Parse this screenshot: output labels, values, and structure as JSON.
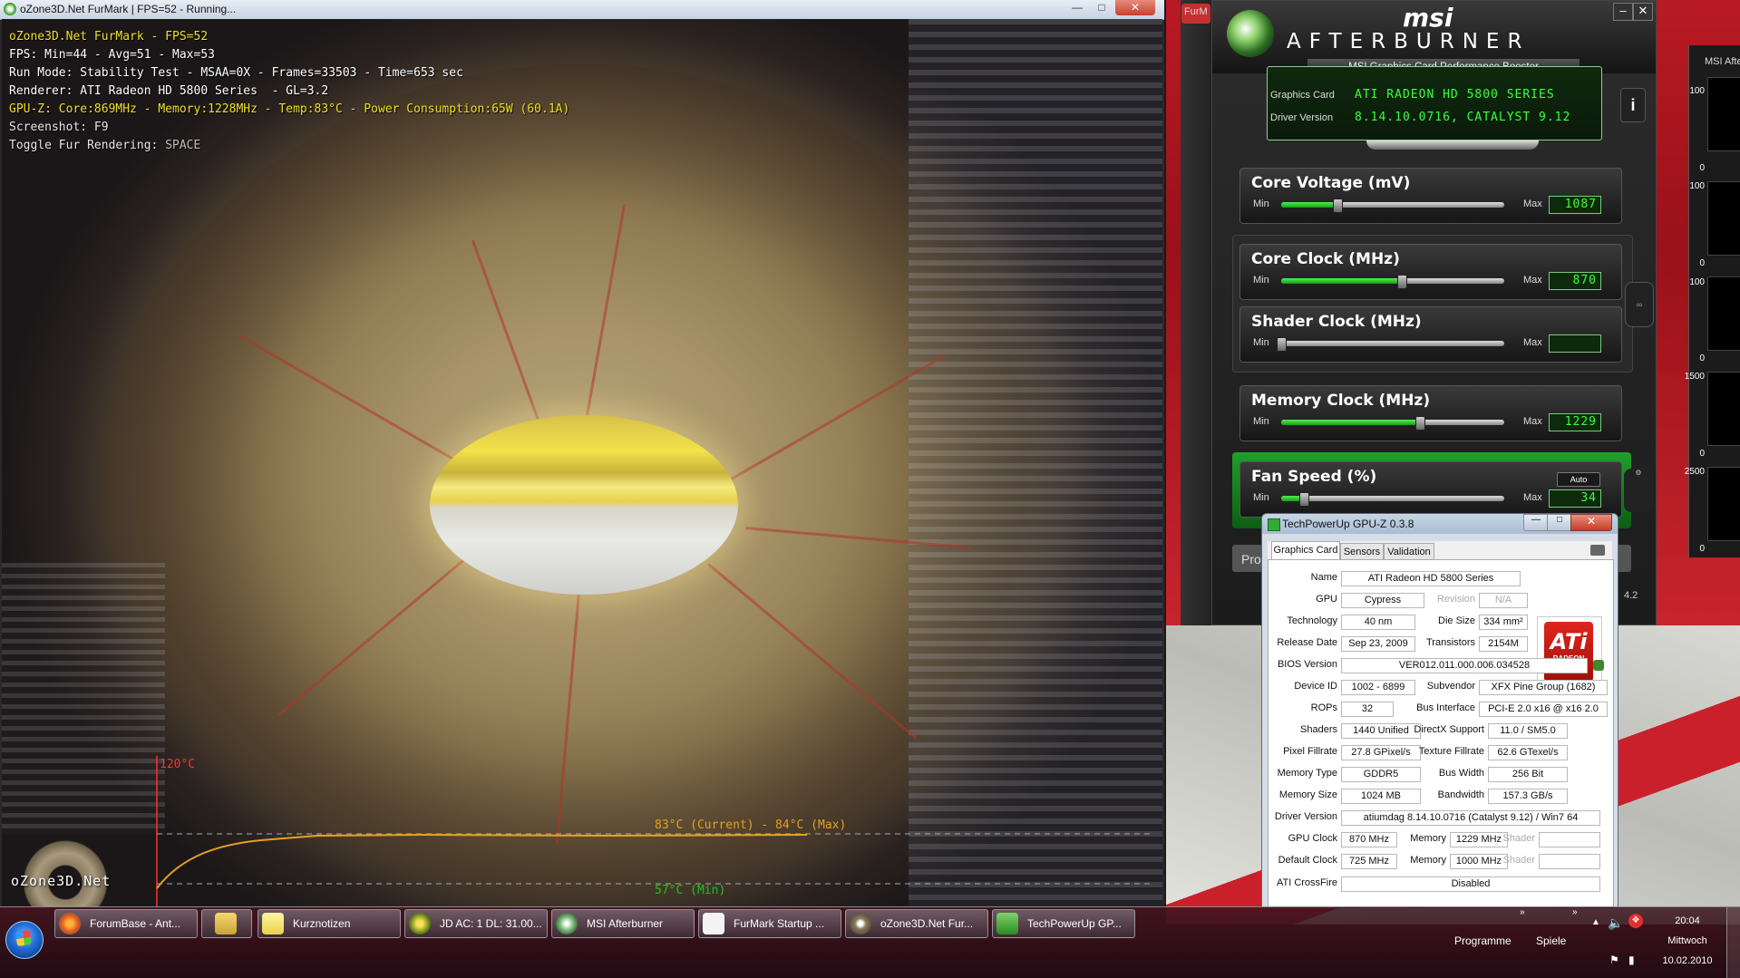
{
  "colors": {
    "furmark_yellow": "#f0e020",
    "ab_green": "#3cff3c",
    "temp_max": "#ff3030",
    "temp_current": "#e8a020",
    "temp_min": "#20c020",
    "ati_red": "#e0251e"
  },
  "furmark": {
    "window_title": "oZone3D.Net FurMark | FPS=52 - Running...",
    "lines": {
      "l1": "oZone3D.Net FurMark - FPS=52",
      "l2": "FPS: Min=44 - Avg=51 - Max=53",
      "l3": "Run Mode: Stability Test - MSAA=0X - Frames=33503 - Time=653 sec",
      "l4": "Renderer: ATI Radeon HD 5800 Series  - GL=3.2",
      "l5": "GPU-Z: Core:869MHz - Memory:1228MHz - Temp:83°C - Power Consumption:65W (60.1A)",
      "l6_label": "Screenshot: ",
      "l6_key": "F9",
      "l7_label": "Toggle Fur Rendering: ",
      "l7_key": "SPACE"
    },
    "graph": {
      "max_label": "120°C",
      "current_label": "83°C (Current) - 84°C (Max)",
      "min_label": "57°C (Min)"
    },
    "logo": "oZone3D.Net"
  },
  "afterburner": {
    "brand": "msi",
    "name": "AFTERBURNER",
    "subtitle": "MSI Graphics Card Performance Booster",
    "edge_title": "FurM",
    "graphics_card_label": "Graphics Card",
    "graphics_card_value": "ATI RADEON HD 5800 SERIES",
    "driver_label": "Driver Version",
    "driver_value": "8.14.10.0716, CATALYST 9.12",
    "min_label": "Min",
    "max_label": "Max",
    "core_voltage": {
      "title": "Core Voltage (mV)",
      "value": "1087",
      "level": 0.25
    },
    "core_clock": {
      "title": "Core Clock (MHz)",
      "value": "870",
      "level": 0.54
    },
    "shader_clock": {
      "title": "Shader Clock (MHz)",
      "value": "",
      "level": 0.0
    },
    "memory_clock": {
      "title": "Memory Clock (MHz)",
      "value": "1229",
      "level": 0.62
    },
    "fan_speed": {
      "title": "Fan Speed (%)",
      "value": "34",
      "level": 0.1,
      "auto": "Auto"
    },
    "bottom_text": "Pro",
    "version": "4.2"
  },
  "monitor": {
    "title": "MSI Afte",
    "ticks": [
      "100",
      "0",
      "100",
      "0",
      "100",
      "0",
      "1500",
      "0",
      "2500",
      "0"
    ]
  },
  "gpuz": {
    "title": "TechPowerUp GPU-Z 0.3.8",
    "tabs": [
      "Graphics Card",
      "Sensors",
      "Validation"
    ],
    "name_label": "Name",
    "name": "ATI Radeon HD 5800 Series",
    "gpu_label": "GPU",
    "gpu": "Cypress",
    "revision_label": "Revision",
    "revision": "N/A",
    "technology_label": "Technology",
    "technology": "40 nm",
    "die_size_label": "Die Size",
    "die_size": "334 mm²",
    "release_date_label": "Release Date",
    "release_date": "Sep 23, 2009",
    "transistors_label": "Transistors",
    "transistors": "2154M",
    "bios_label": "BIOS Version",
    "bios": "VER012.011.000.006.034528",
    "device_id_label": "Device ID",
    "device_id": "1002 - 6899",
    "subvendor_label": "Subvendor",
    "subvendor": "XFX Pine Group (1682)",
    "rops_label": "ROPs",
    "rops": "32",
    "bus_interface_label": "Bus Interface",
    "bus_interface": "PCI-E 2.0 x16 @ x16 2.0",
    "shaders_label": "Shaders",
    "shaders": "1440 Unified",
    "directx_label": "DirectX Support",
    "directx": "11.0 / SM5.0",
    "pixel_fillrate_label": "Pixel Fillrate",
    "pixel_fillrate": "27.8 GPixel/s",
    "texture_fillrate_label": "Texture Fillrate",
    "texture_fillrate": "62.6 GTexel/s",
    "memory_type_label": "Memory Type",
    "memory_type": "GDDR5",
    "bus_width_label": "Bus Width",
    "bus_width": "256 Bit",
    "memory_size_label": "Memory Size",
    "memory_size": "1024 MB",
    "bandwidth_label": "Bandwidth",
    "bandwidth": "157.3 GB/s",
    "driver_version_label": "Driver Version",
    "driver_version": "atiumdag 8.14.10.0716 (Catalyst 9.12) / Win7 64",
    "gpu_clock_label": "GPU Clock",
    "gpu_clock": "870 MHz",
    "memory_label": "Memory",
    "memory_clock": "1229 MHz",
    "shader_label": "Shader",
    "default_clock_label": "Default Clock",
    "default_clock": "725 MHz",
    "default_memory_clock": "1000 MHz",
    "crossfire_label": "ATI CrossFire",
    "crossfire": "Disabled",
    "logo_text": "ATi",
    "logo_sub": "RADEON",
    "logo_gfx": "GRAPHICS"
  },
  "taskbar": {
    "items": [
      {
        "label": "ForumBase - Ant..."
      },
      {
        "label": ""
      },
      {
        "label": "Kurznotizen"
      },
      {
        "label": "JD AC: 1 DL: 31.00..."
      },
      {
        "label": "MSI Afterburner"
      },
      {
        "label": "FurMark Startup ..."
      },
      {
        "label": "oZone3D.Net Fur..."
      },
      {
        "label": "TechPowerUp GP..."
      }
    ],
    "programme": "Programme",
    "spiele": "Spiele",
    "time": "20:04",
    "day": "Mittwoch",
    "date": "10.02.2010"
  }
}
